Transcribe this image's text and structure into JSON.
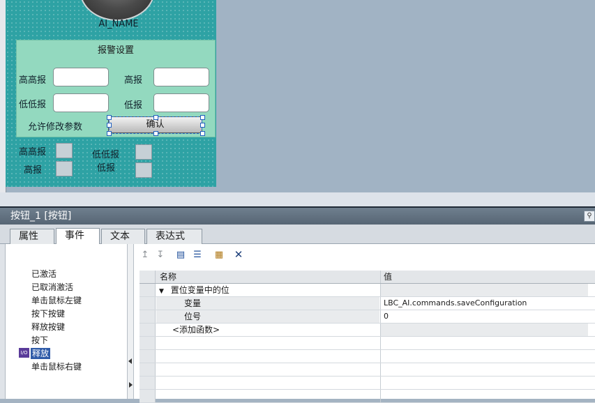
{
  "canvas": {
    "gauge_name": "AI_NAME",
    "alarm_settings": {
      "title": "报警设置",
      "high_high_label": "高高报",
      "high_label": "高报",
      "low_low_label": "低低报",
      "low_label": "低报",
      "allow_modify_label": "允许修改参数",
      "confirm_button": "确认",
      "high_high_value": "",
      "high_value": "",
      "low_low_value": "",
      "low_value": ""
    },
    "indicators": {
      "high_high": "高高报",
      "high": "高报",
      "low_low": "低低报",
      "low": "低报"
    }
  },
  "inspector": {
    "title": "按钮_1 [按钮]",
    "tabs": [
      "属性",
      "事件",
      "文本",
      "表达式"
    ],
    "active_tab": "事件",
    "events": [
      "已激活",
      "已取消激活",
      "单击鼠标左键",
      "按下按键",
      "释放按键",
      "按下",
      "释放",
      "单击鼠标右键"
    ],
    "selected_event": "释放",
    "toolbar_icons": [
      "move-up-icon",
      "move-down-icon",
      "collapse-icon",
      "expand-icon",
      "script-icon",
      "delete-icon"
    ],
    "grid": {
      "header": {
        "name": "名称",
        "value": "值"
      },
      "function_name": "置位变量中的位",
      "params": [
        {
          "name": "变量",
          "value": "LBC_AI.commands.saveConfiguration"
        },
        {
          "name": "位号",
          "value": "0"
        }
      ],
      "add_function": "<添加函数>"
    }
  },
  "colors": {
    "faceplate": "#2ea2a4",
    "alarm_group": "#93d9bf",
    "selection": "#2f5ba8"
  }
}
